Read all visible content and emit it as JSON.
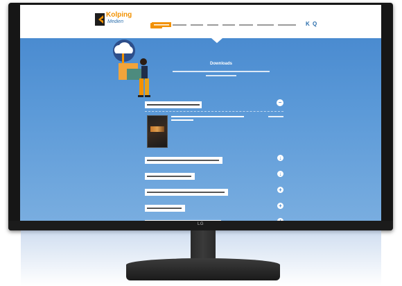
{
  "site": {
    "logo_text": "Kolping",
    "logo_sub": "Medien",
    "nav_items": [
      "",
      "",
      "",
      "",
      "",
      "",
      "",
      ""
    ],
    "search_icon_label": "Q",
    "home_icon_label": "K"
  },
  "hero": {
    "title": "Downloads",
    "description": ""
  },
  "accordion": {
    "items": [
      {
        "label": "",
        "toggle": "−"
      },
      {
        "label": "",
        "toggle": "↓"
      },
      {
        "label": "",
        "toggle": "↓"
      },
      {
        "label": "",
        "toggle": "+"
      },
      {
        "label": "",
        "toggle": "+"
      },
      {
        "label": "",
        "toggle": "+"
      }
    ],
    "open_panel": {
      "text": "",
      "link": ""
    }
  },
  "monitor": {
    "brand": "LG"
  },
  "colors": {
    "accent": "#f29100",
    "brand_blue": "#2c6fad",
    "hero_blue": "#4a8bd0"
  }
}
